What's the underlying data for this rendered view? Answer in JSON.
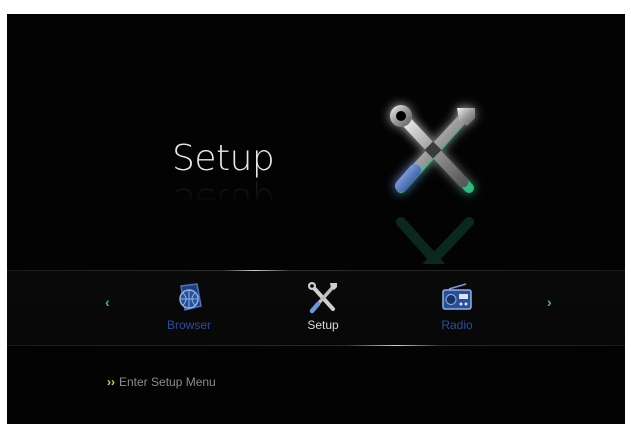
{
  "hero": {
    "title": "Setup",
    "icon": "tools-icon"
  },
  "menu": {
    "items": [
      {
        "label": "Browser",
        "icon": "globe-icon",
        "active": false
      },
      {
        "label": "Setup",
        "icon": "tools-icon",
        "active": true
      },
      {
        "label": "Radio",
        "icon": "radio-icon",
        "active": false
      }
    ],
    "left_arrow": "‹",
    "right_arrow": "›"
  },
  "hint": {
    "prefix": "››",
    "text": "Enter Setup Menu"
  },
  "colors": {
    "background": "#030303",
    "accent_glow": "#2ecf8a",
    "dim_label": "#2a4e9a",
    "hint_chevron": "#e8d040"
  }
}
